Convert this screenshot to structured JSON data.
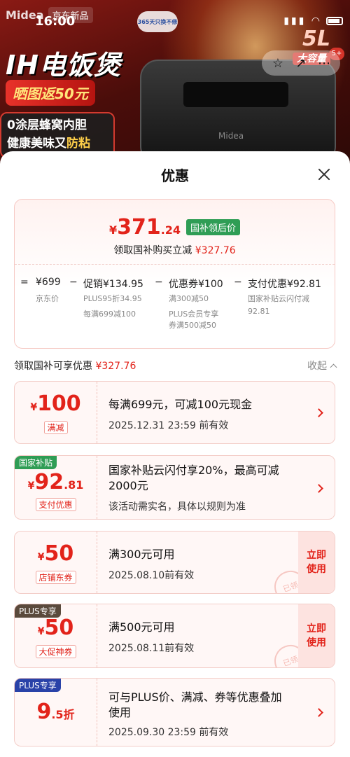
{
  "status_bar": {
    "time": "16:00"
  },
  "banner": {
    "brand": "Midea",
    "store_badge": "京东新品",
    "service_badge": "365天只换不修",
    "headline": "IH电饭煲",
    "promo_line": "晒图返50元",
    "feature_line1": "0涂层蜂窝内胆",
    "feature_line2_prefix": "健康美味又",
    "feature_line2_highlight": "防粘",
    "capacity_big": "5L",
    "capacity_small": "大容量",
    "capacity_badge": "5+",
    "cooker_brand": "Midea"
  },
  "sheet": {
    "title": "优惠",
    "summary": {
      "currency": "¥",
      "price_int": "371",
      "price_dec": ".24",
      "price_tag": "国补领后价",
      "subtitle_prefix": "领取国补购买立减",
      "subtitle_amount": "¥327.76",
      "breakdown": {
        "eq": "=",
        "jd_price": "¥699",
        "minus1": "−",
        "promo": "促销¥134.95",
        "minus2": "−",
        "coupon": "优惠券¥100",
        "minus3": "−",
        "pay": "支付优惠¥92.81",
        "jd_price_label": "京东价",
        "promo_note1": "PLUS95折34.95",
        "promo_note2": "每满699减100",
        "coupon_note1": "满300减50",
        "coupon_note2a": "PLUS会员专享",
        "coupon_note2b": "券满500减50",
        "pay_note1": "国家补贴云闪付减",
        "pay_note2": "92.81"
      }
    },
    "section": {
      "label": "领取国补可享优惠",
      "amount": "¥327.76",
      "collapse": "收起"
    },
    "cards": [
      {
        "cur": "¥",
        "int": "100",
        "dec": "",
        "type": "满减",
        "main": "每满699元，可减100元现金",
        "meta": "2025.12.31 23:59 前有效"
      },
      {
        "tag": "国家补贴",
        "cur": "¥",
        "int": "92",
        "dec": ".81",
        "type": "支付优惠",
        "main1": "国家补贴云闪付享20%，最高可减",
        "main2": "2000元",
        "meta": "该活动需实名，具体以规则为准"
      },
      {
        "cur": "¥",
        "int": "50",
        "dec": "",
        "type": "店铺东券",
        "main": "满300元可用",
        "meta": "2025.08.10前有效",
        "action1": "立即",
        "action2": "使用",
        "stamp": "已领"
      },
      {
        "tag": "PLUS专享",
        "cur": "¥",
        "int": "50",
        "dec": "",
        "type": "大促神券",
        "main": "满500元可用",
        "meta": "2025.08.11前有效",
        "action1": "立即",
        "action2": "使用",
        "stamp": "已领"
      },
      {
        "tag": "PLUS专享",
        "int": "9",
        "dec": ".5折",
        "main1": "可与PLUS价、满减、券等优惠叠加",
        "main2": "使用",
        "meta": "2025.09.30 23:59 前有效"
      }
    ]
  },
  "colors": {
    "accent_red": "#e2231a",
    "tag_green": "#2f9d55",
    "tag_dark": "#5a4a3c",
    "tag_blue": "#2942a8"
  }
}
